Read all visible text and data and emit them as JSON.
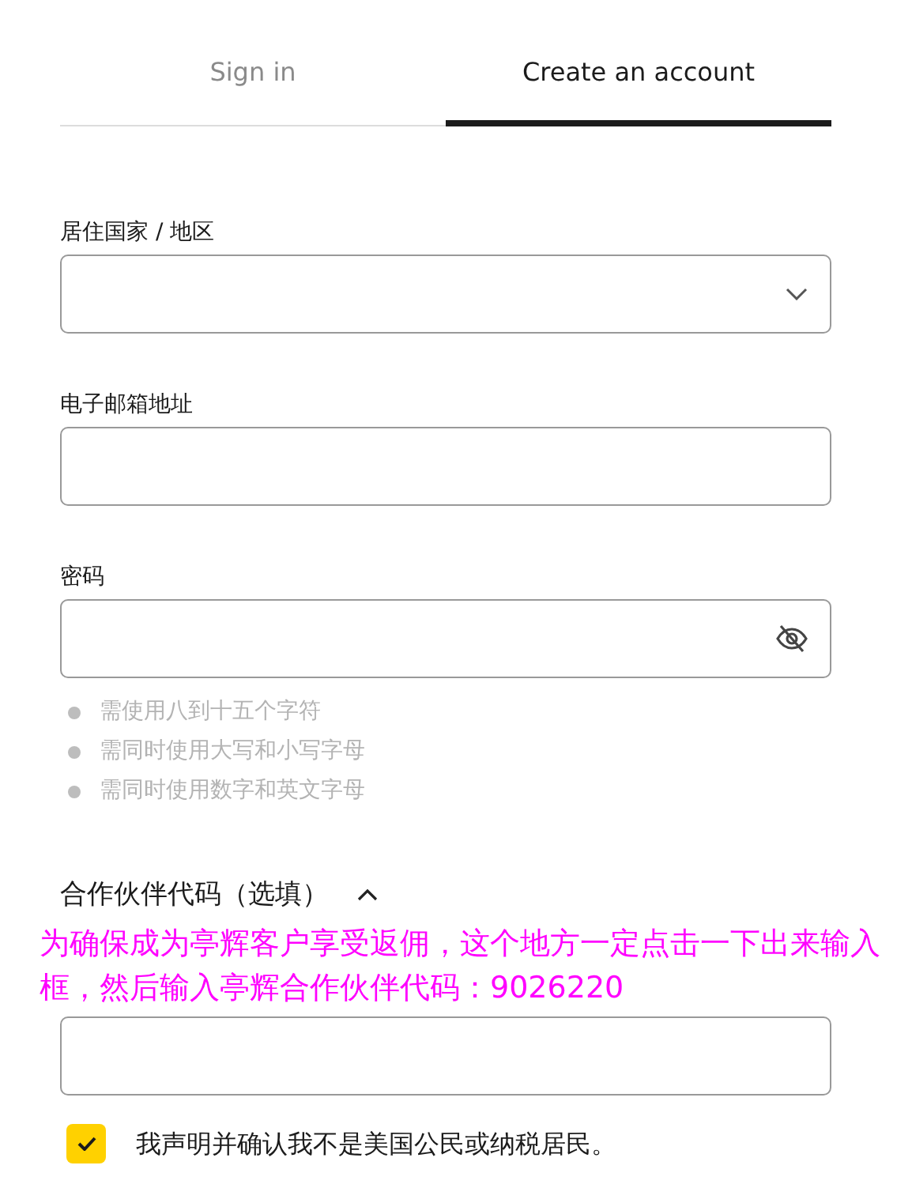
{
  "tabs": [
    {
      "label": "Sign in",
      "selected": false
    },
    {
      "label": "Create an account",
      "selected": true
    }
  ],
  "fields": [
    {
      "label": "居住国家 / 地区",
      "kind": "select"
    },
    {
      "label": "电子邮箱地址",
      "kind": "text"
    },
    {
      "label": "密码",
      "kind": "password"
    }
  ],
  "password_rules": [
    "需使用八到十五个字符",
    "需同时使用大写和小写字母",
    "需同时使用数字和英文字母"
  ],
  "partner_code": {
    "label": "合作伙伴代码（选填）",
    "expanded": true
  },
  "annotation": "为确保成为亭辉客户享受返佣，这个地方一定点击一下出来输入框，然后输入亭辉合作伙伴代码：9026220",
  "declaration": {
    "label": "我声明并确认我不是美国公民或纳税居民。",
    "checked": true
  }
}
